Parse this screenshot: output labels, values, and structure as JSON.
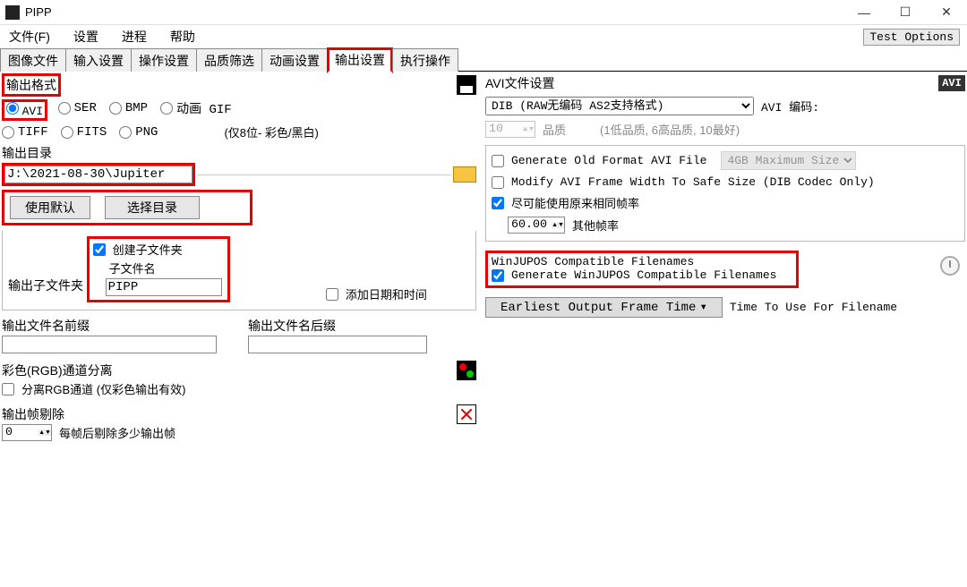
{
  "window": {
    "title": "PIPP"
  },
  "winbtns": {
    "min": "—",
    "max": "☐",
    "close": "✕"
  },
  "menubar": {
    "file": "文件(F)",
    "settings": "设置",
    "process": "进程",
    "help": "帮助",
    "test_options": "Test Options"
  },
  "tabs": {
    "image_files": "图像文件",
    "input_settings": "输入设置",
    "operation_settings": "操作设置",
    "quality_filter": "品质筛选",
    "animation_settings": "动画设置",
    "output_settings": "输出设置",
    "execute": "执行操作"
  },
  "output_format": {
    "title": "输出格式",
    "avi": "AVI",
    "ser": "SER",
    "bmp": "BMP",
    "agif": "动画 GIF",
    "tiff": "TIFF",
    "fits": "FITS",
    "png": "PNG",
    "note": "(仅8位- 彩色/黑白)"
  },
  "output_dir": {
    "title": "输出目录",
    "path": "J:\\2021-08-30\\Jupiter",
    "use_default": "使用默认",
    "choose_dir": "选择目录"
  },
  "sub_folder": {
    "title": "输出子文件夹",
    "create": "创建子文件夹",
    "sub_name_label": "子文件名",
    "sub_name": "PIPP",
    "add_datetime": "添加日期和时间"
  },
  "filename_prefix": {
    "title": "输出文件名前缀",
    "value": ""
  },
  "filename_suffix": {
    "title": "输出文件名后缀",
    "value": ""
  },
  "rgb": {
    "title": "彩色(RGB)通道分离",
    "separate": "分离RGB通道 (仅彩色输出有效)"
  },
  "frame_drop": {
    "title": "输出帧剔除",
    "value": "0",
    "label": "每帧后剔除多少输出帧"
  },
  "avi_settings": {
    "title": "AVI文件设置",
    "codec": "DIB (RAW无编码 AS2支持格式)",
    "codec_label": "AVI 编码:",
    "quality_value": "10",
    "quality_label": "品质",
    "quality_hint": "(1低品质, 6高品质, 10最好)",
    "old_format": "Generate Old Format AVI File",
    "maxsize": "4GB Maximum Size",
    "safe_width": "Modify AVI Frame Width To Safe Size (DIB Codec Only)",
    "same_fps": "尽可能使用原来相同帧率",
    "fps_value": "60.00",
    "other_fps": "其他帧率"
  },
  "winjupos": {
    "title": "WinJUPOS Compatible Filenames",
    "generate": "Generate WinJUPOS Compatible Filenames",
    "time_btn": "Earliest Output Frame Time",
    "time_label": "Time To Use For Filename"
  },
  "avi_badge": "AVI"
}
